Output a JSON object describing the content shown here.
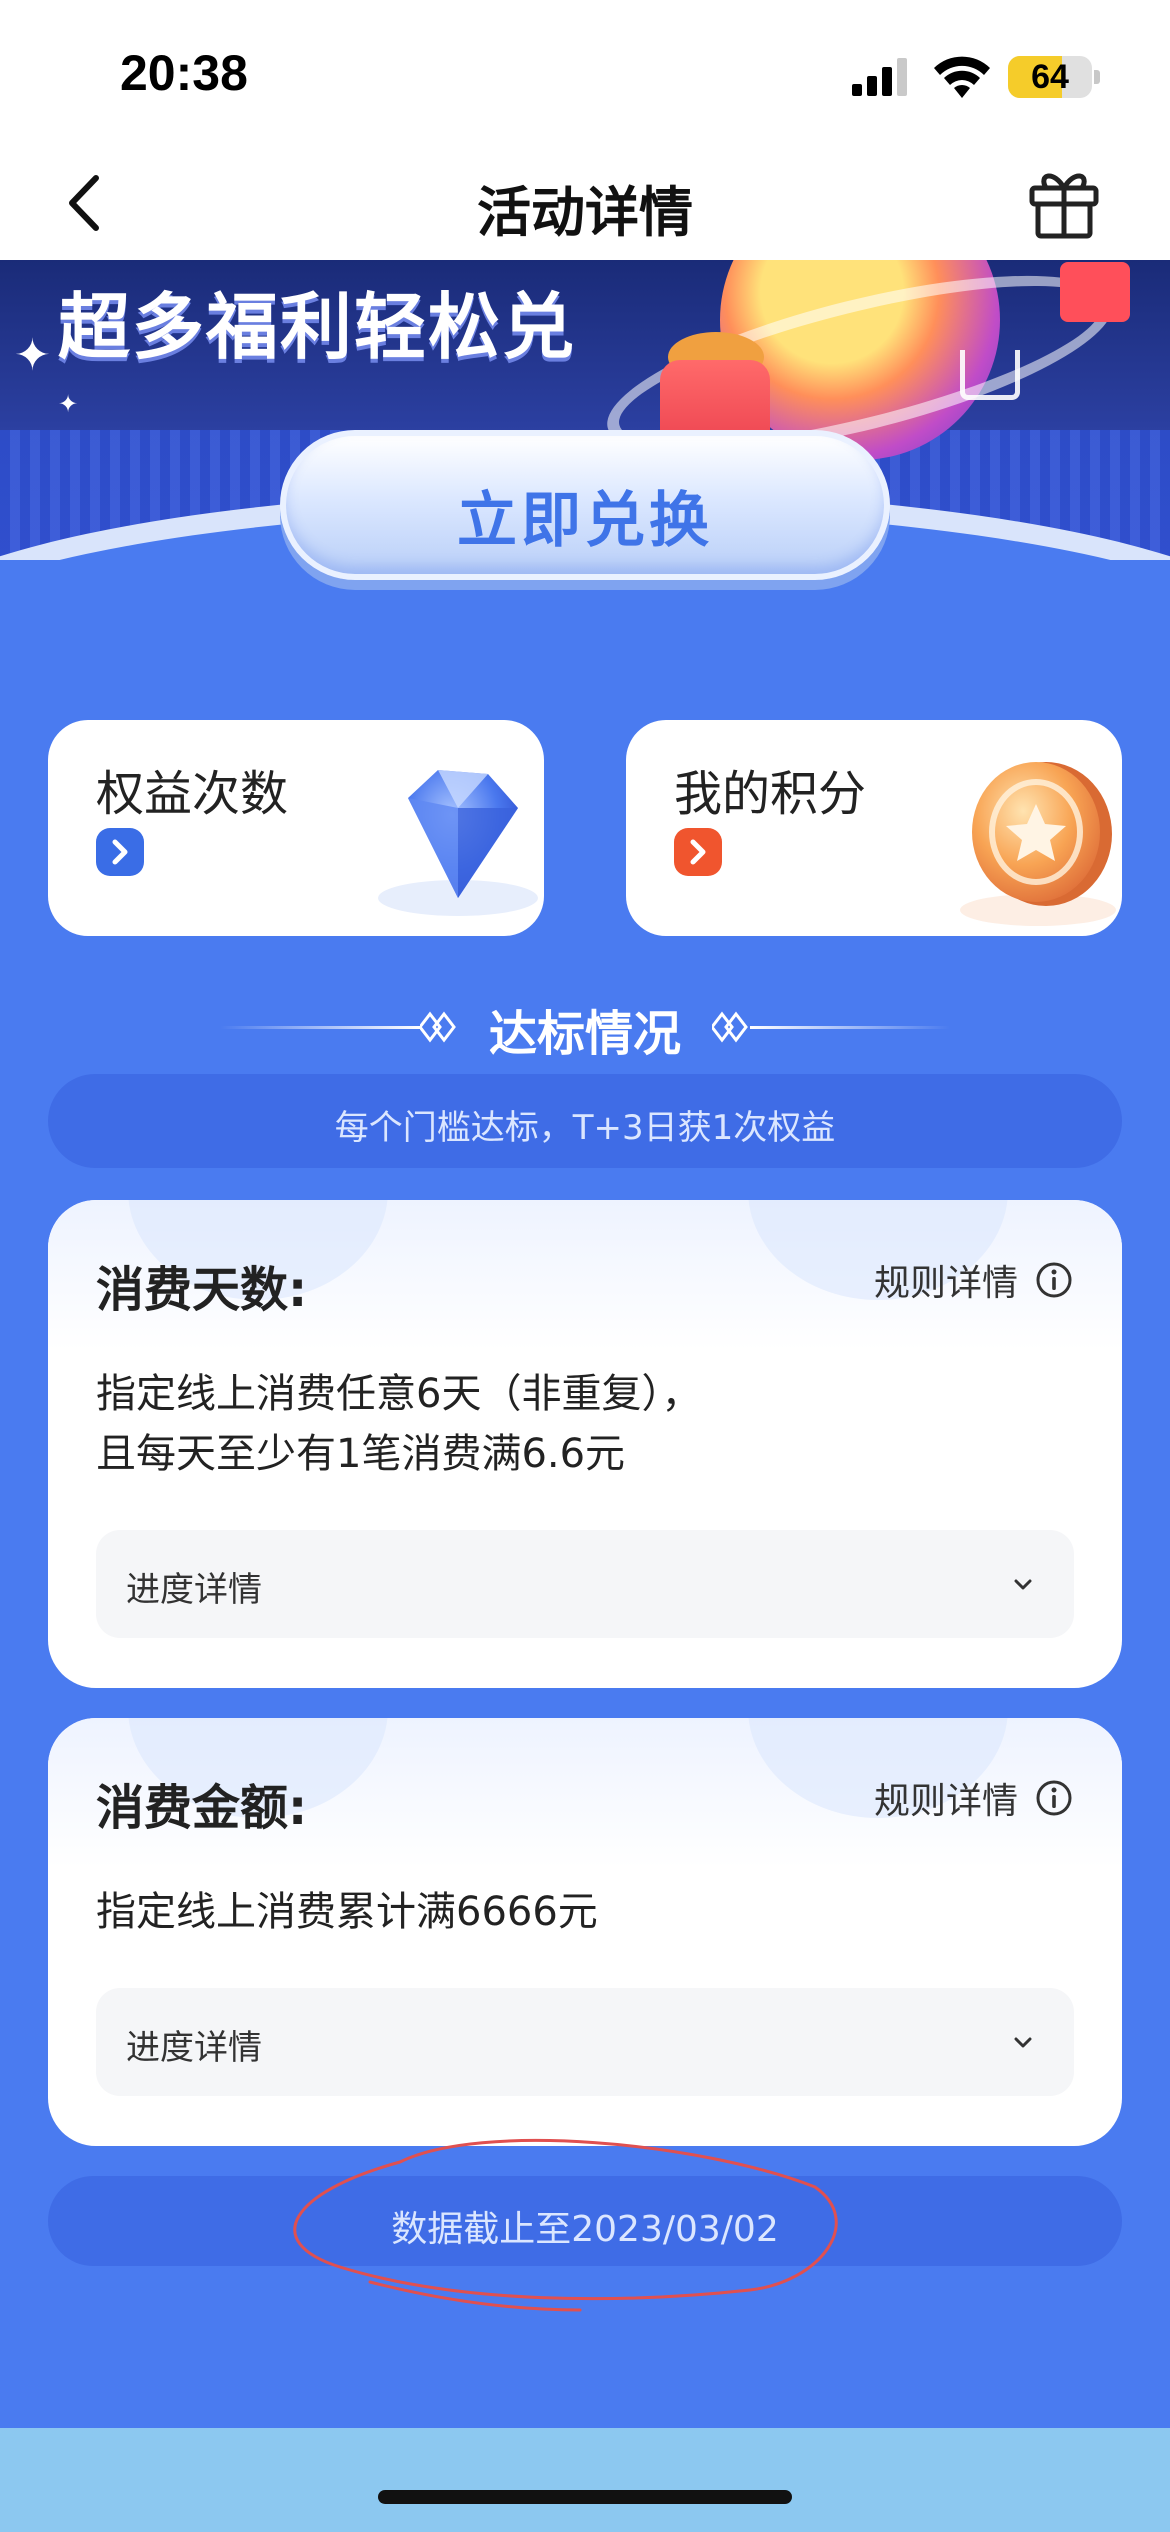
{
  "status_bar": {
    "time": "20:38",
    "battery_level": "64",
    "battery_fraction": 0.64,
    "icons": [
      "signal-icon",
      "wifi-icon",
      "battery-icon"
    ]
  },
  "nav": {
    "title": "活动详情",
    "back_icon": "chevron-left-icon",
    "gift_icon": "gift-icon"
  },
  "banner": {
    "headline": "超多福利轻松兑",
    "exchange_button": "立即兑换"
  },
  "benefits": [
    {
      "label": "权益次数",
      "arrow_color": "#3a6de6",
      "icon": "diamond-icon"
    },
    {
      "label": "我的积分",
      "arrow_color": "#f0552e",
      "icon": "coin-icon"
    }
  ],
  "section": {
    "title": "达标情况",
    "notice": "每个门槛达标，T+3日获1次权益"
  },
  "tasks": [
    {
      "title": "消费天数:",
      "rules_link": "规则详情",
      "desc_lines": [
        "指定线上消费任意6天（非重复），",
        "且每天至少有1笔消费满6.6元"
      ],
      "progress_label": "进度详情"
    },
    {
      "title": "消费金额:",
      "rules_link": "规则详情",
      "desc_lines": [
        "指定线上消费累计满6666元"
      ],
      "progress_label": "进度详情"
    }
  ],
  "footer": {
    "cutoff": "数据截止至2023/03/02"
  },
  "colors": {
    "page_bg": "#4a7bf0",
    "pill_bg": "#3f6ce6",
    "annotation": "#e05050",
    "bottom_band": "#8cc8f0"
  }
}
